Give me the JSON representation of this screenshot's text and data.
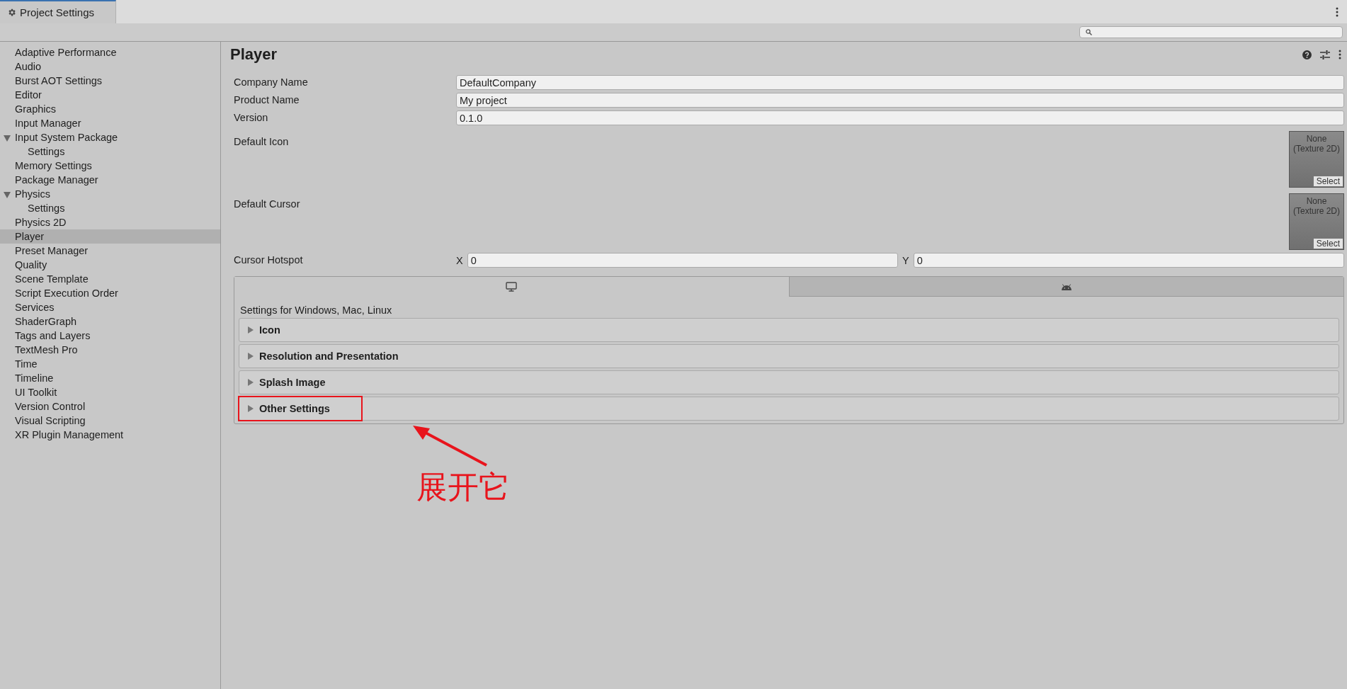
{
  "window": {
    "tab": {
      "title": "Project Settings",
      "selected": true
    }
  },
  "sidebar": {
    "items": [
      {
        "label": "Adaptive Performance",
        "selected": false
      },
      {
        "label": "Audio",
        "selected": false
      },
      {
        "label": "Burst AOT Settings",
        "selected": false
      },
      {
        "label": "Editor",
        "selected": false
      },
      {
        "label": "Graphics",
        "selected": false
      },
      {
        "label": "Input Manager",
        "selected": false
      },
      {
        "label": "Input System Package",
        "selected": false,
        "expanded": true,
        "children": [
          {
            "label": "Settings",
            "selected": false
          }
        ]
      },
      {
        "label": "Memory Settings",
        "selected": false
      },
      {
        "label": "Package Manager",
        "selected": false
      },
      {
        "label": "Physics",
        "selected": false,
        "expanded": true,
        "children": [
          {
            "label": "Settings",
            "selected": false
          }
        ]
      },
      {
        "label": "Physics 2D",
        "selected": false
      },
      {
        "label": "Player",
        "selected": true
      },
      {
        "label": "Preset Manager",
        "selected": false
      },
      {
        "label": "Quality",
        "selected": false
      },
      {
        "label": "Scene Template",
        "selected": false
      },
      {
        "label": "Script Execution Order",
        "selected": false
      },
      {
        "label": "Services",
        "selected": false
      },
      {
        "label": "ShaderGraph",
        "selected": false
      },
      {
        "label": "Tags and Layers",
        "selected": false
      },
      {
        "label": "TextMesh Pro",
        "selected": false
      },
      {
        "label": "Time",
        "selected": false
      },
      {
        "label": "Timeline",
        "selected": false
      },
      {
        "label": "UI Toolkit",
        "selected": false
      },
      {
        "label": "Version Control",
        "selected": false
      },
      {
        "label": "Visual Scripting",
        "selected": false
      },
      {
        "label": "XR Plugin Management",
        "selected": false
      }
    ]
  },
  "inspector": {
    "title": "Player",
    "fields": [
      {
        "kind": "text",
        "label": "Company Name",
        "value": "DefaultCompany"
      },
      {
        "kind": "text",
        "label": "Product Name",
        "value": "My project"
      },
      {
        "kind": "text",
        "label": "Version",
        "value": "0.1.0"
      },
      {
        "kind": "object",
        "label": "Default Icon",
        "value": "None (Texture 2D)",
        "button": "Select"
      },
      {
        "kind": "object",
        "label": "Default Cursor",
        "value": "None (Texture 2D)",
        "button": "Select"
      },
      {
        "kind": "vector",
        "label": "Cursor Hotspot",
        "x_label": "X",
        "x_value": "0",
        "y_label": "Y",
        "y_value": "0"
      }
    ],
    "platform_tabs": [
      {
        "kind": "desktop",
        "selected": true
      },
      {
        "kind": "android",
        "selected": false
      }
    ],
    "platform_caption": "Settings for Windows, Mac, Linux",
    "sections": [
      {
        "label": "Icon",
        "expanded": false,
        "highlighted": false
      },
      {
        "label": "Resolution and Presentation",
        "expanded": false,
        "highlighted": false
      },
      {
        "label": "Splash Image",
        "expanded": false,
        "highlighted": false
      },
      {
        "label": "Other Settings",
        "expanded": false,
        "highlighted": true
      }
    ]
  },
  "annotation": {
    "text": "展开它"
  }
}
